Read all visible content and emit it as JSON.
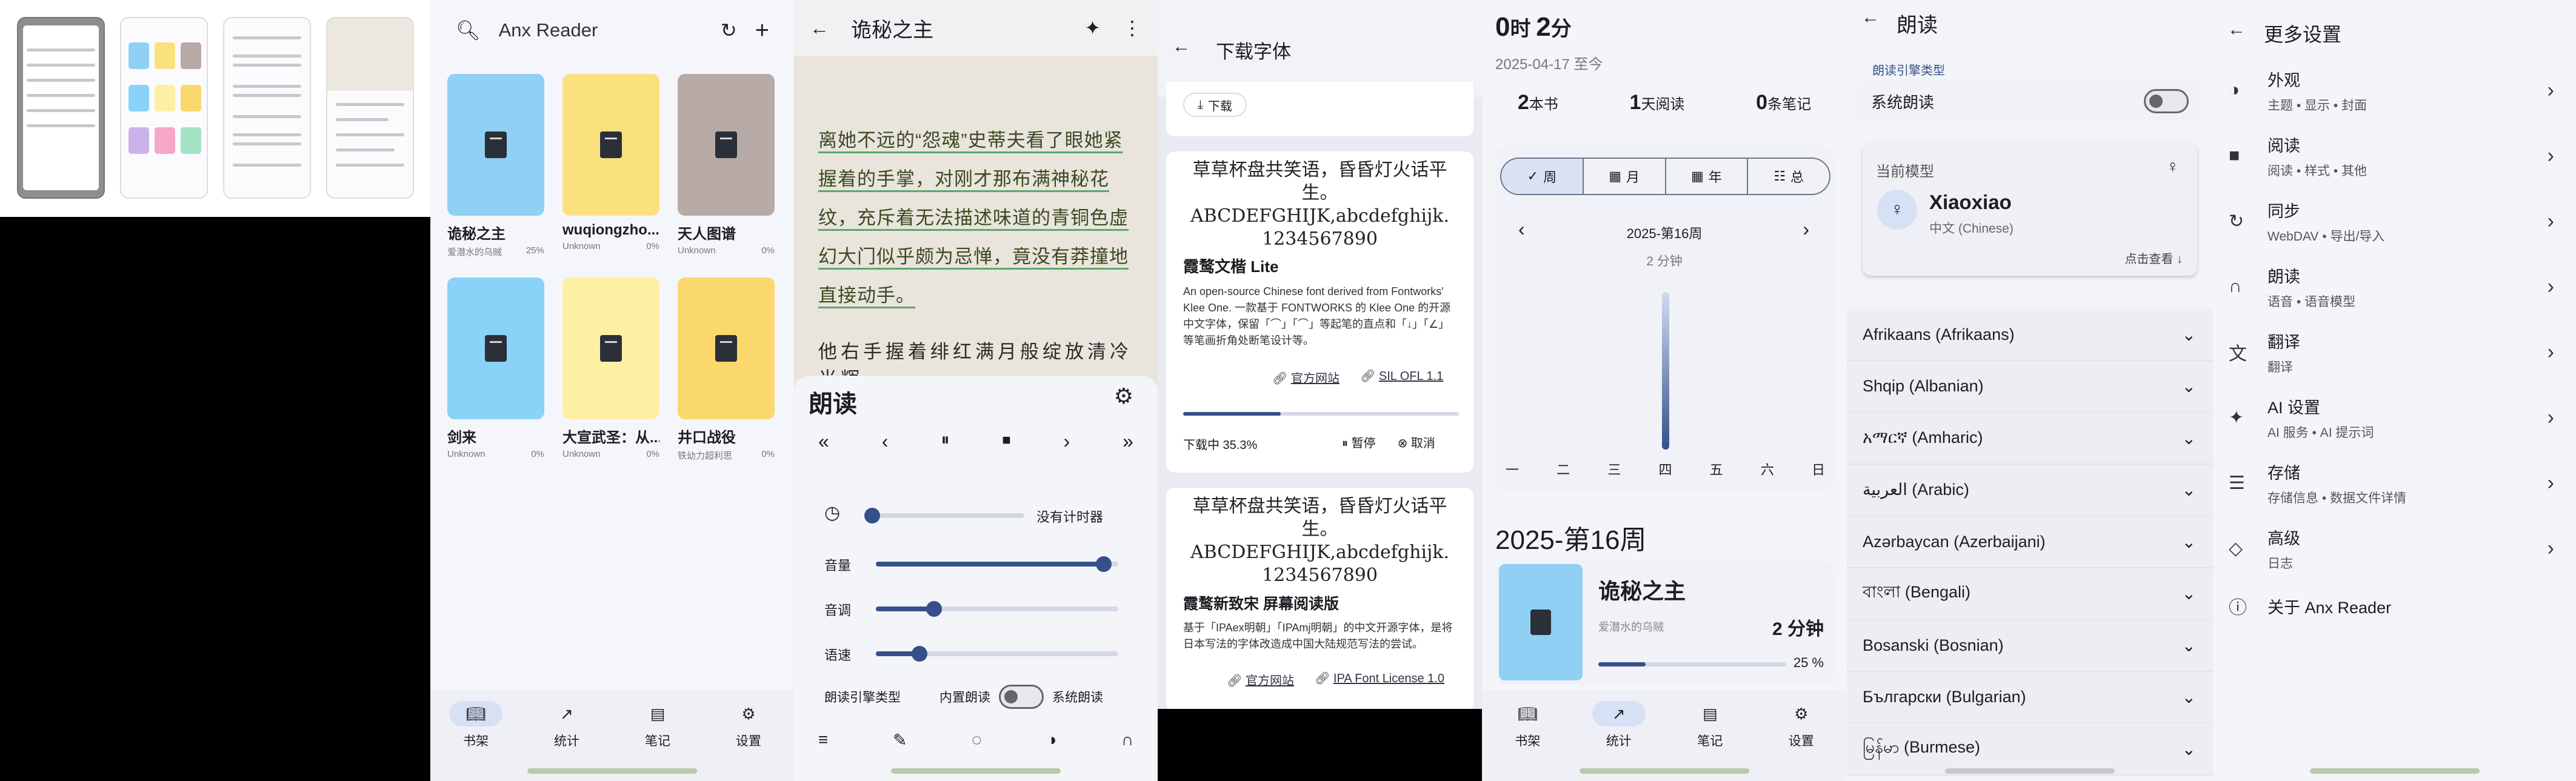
{
  "shelf": {
    "search_placeholder": "Anx Reader",
    "books": [
      {
        "title": "诡秘之主",
        "author": "爱潜水的乌贼",
        "progress": "25%",
        "color": "#8fd0f4"
      },
      {
        "title": "wuqiongzho...",
        "author": "Unknown",
        "progress": "0%",
        "color": "#fbe07e"
      },
      {
        "title": "天人图谱",
        "author": "Unknown",
        "progress": "0%",
        "color": "#b8aaa6"
      },
      {
        "title": "剑来",
        "author": "Unknown",
        "progress": "0%",
        "color": "#8ad2f7"
      },
      {
        "title": "大宣武圣：从...",
        "author": "Unknown",
        "progress": "0%",
        "color": "#fdf0a2"
      },
      {
        "title": "井口战役",
        "author": "铁幼力超利思",
        "progress": "0%",
        "color": "#fad86d"
      }
    ]
  },
  "nav": {
    "shelf": "书架",
    "stats": "统计",
    "notes": "笔记",
    "settings": "设置"
  },
  "reader": {
    "title": "诡秘之主",
    "para1": "离她不远的“怨魂”史蒂夫看了眼她紧握着的手掌，对刚才那布满神秘花纹，充斥着无法描述味道的青铜色虚幻大门似乎颇为忌惮，竟没有莽撞地直接动手。",
    "para2": "他右手握着绯红满月般绽放清冷光辉",
    "sheet_title": "朗读",
    "timer_label": "没有计时器",
    "volume_label": "音量",
    "pitch_label": "音调",
    "rate_label": "语速",
    "volume": 0.94,
    "pitch": 0.24,
    "rate": 0.18,
    "engine_type_label": "朗读引擎类型",
    "engine_builtin": "内置朗读",
    "engine_system": "系统朗读"
  },
  "fonts": {
    "title": "下载字体",
    "download_btn": "下载",
    "sample": "草草杯盘共笑语，昏昏灯火话平生。ABCDEFGHIJK,abcdefghijk. 1234567890",
    "font1": {
      "name": "霞鹜文楷 Lite",
      "desc": "An open-source Chinese font derived from Fontworks' Klee One. 一款基于 FONTWORKS 的 Klee One 的开源中文字体，保留「⌒」「⌒」等起笔的直点和「↓」「∠」等笔画折角处断笔设计等。",
      "site": "官方网站",
      "license": "SIL OFL 1.1",
      "status": "下载中 35.3%",
      "progress": 0.353,
      "pause": "暂停",
      "cancel": "取消"
    },
    "font2": {
      "name": "霞鹜新致宋 屏幕阅读版",
      "desc": "基于「IPAex明朝」「IPAmj明朝」的中文开源字体，是将日本写法的字体改造成中国大陆规范写法的尝试。",
      "site": "官方网站",
      "license": "IPA Font License 1.0"
    }
  },
  "stats": {
    "time_h": "0",
    "time_h_unit": "时",
    "time_m": "2",
    "time_m_unit": "分",
    "since": "2025-04-17 至今",
    "books_n": "2",
    "books_u": "本书",
    "days_n": "1",
    "days_u": "天阅读",
    "notes_n": "0",
    "notes_u": "条笔记",
    "tabs": [
      "周",
      "月",
      "年",
      "总"
    ],
    "week_label": "2025-第16周",
    "week_total": "2 分钟",
    "days": [
      "一",
      "二",
      "三",
      "四",
      "五",
      "六",
      "日"
    ],
    "day_values": [
      0,
      0,
      0,
      2,
      0,
      0,
      0
    ],
    "section_title": "2025-第16周",
    "book_title": "诡秘之主",
    "book_author": "爱潜水的乌贼",
    "book_time": "2 分钟",
    "book_progress": "25 %",
    "book_progress_value": 0.25
  },
  "tts": {
    "title": "朗读",
    "engine_type": "朗读引擎类型",
    "system_tts": "系统朗读",
    "current_model_label": "当前模型",
    "model_name": "Xiaoxiao",
    "model_lang": "中文 (Chinese)",
    "view_more": "点击查看",
    "languages": [
      "Afrikaans (Afrikaans)",
      "Shqip (Albanian)",
      "አማርኛ (Amharic)",
      "العربية (Arabic)",
      "Azərbaycan (Azerbaijani)",
      "বাংলা (Bengali)",
      "Bosanski (Bosnian)",
      "Български (Bulgarian)",
      "မြန်မာ (Burmese)"
    ]
  },
  "settings": {
    "title": "更多设置",
    "rows": [
      {
        "title": "外观",
        "sub": "主题 • 显示 • 封面",
        "icon": "palette-icon"
      },
      {
        "title": "阅读",
        "sub": "阅读 • 样式 • 其他",
        "icon": "book-icon"
      },
      {
        "title": "同步",
        "sub": "WebDAV • 导出/导入",
        "icon": "sync-icon"
      },
      {
        "title": "朗读",
        "sub": "语音 • 语音模型",
        "icon": "headphones-icon"
      },
      {
        "title": "翻译",
        "sub": "翻译",
        "icon": "translate-icon"
      },
      {
        "title": "AI 设置",
        "sub": "AI 服务 • AI 提示词",
        "icon": "sparkle-icon"
      },
      {
        "title": "存储",
        "sub": "存储信息 • 数据文件详情",
        "icon": "storage-icon"
      },
      {
        "title": "高级",
        "sub": "日志",
        "icon": "shield-icon"
      },
      {
        "title": "关于 Anx Reader",
        "sub": "",
        "icon": "info-icon"
      }
    ]
  }
}
